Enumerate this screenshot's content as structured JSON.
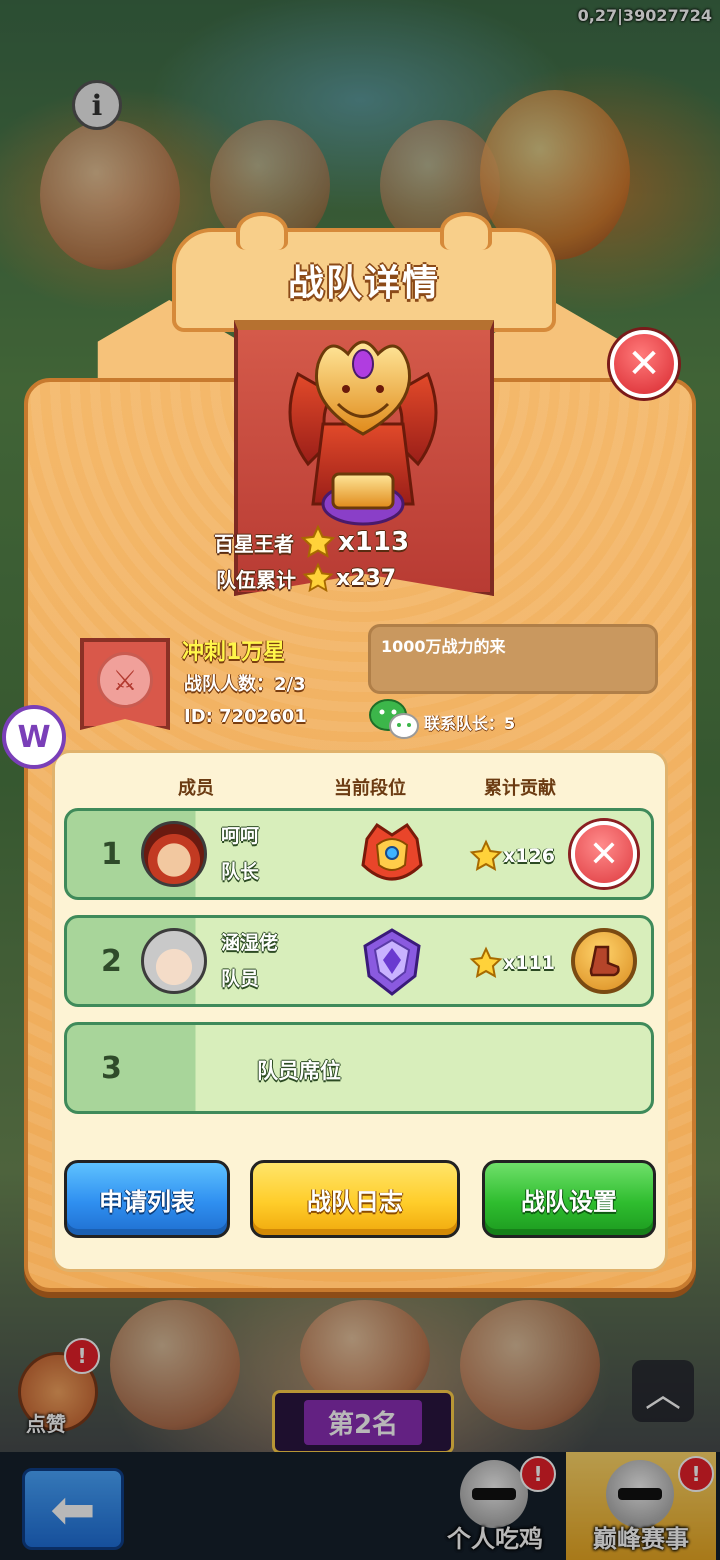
{
  "status": {
    "version_text": "0,27|39027724"
  },
  "background": {
    "like_label": "点赞",
    "rank_badge": "第2名",
    "tabs": [
      {
        "label": "个人吃鸡",
        "badge": "!"
      },
      {
        "label": "巅峰赛事",
        "badge": "!"
      }
    ],
    "like_badge": "!",
    "info_icon": "i",
    "side_icon_letter": "W"
  },
  "dialog": {
    "title": "战队详情",
    "close_glyph": "✕",
    "stats": [
      {
        "label": "百星王者",
        "value": "x113"
      },
      {
        "label": "队伍累计",
        "value": "x237"
      }
    ],
    "team": {
      "name": "冲刺1万星",
      "member_count": "战队人数：2/3",
      "id": "ID: 7202601",
      "motto": "1000万战力的来",
      "contact": "联系队长：5"
    },
    "columns": {
      "member": "成员",
      "rank": "当前段位",
      "contribution": "累计贡献"
    },
    "members": [
      {
        "index": "1",
        "name": "呵呵",
        "role": "队长",
        "contribution": "x126",
        "action": "kick"
      },
      {
        "index": "2",
        "name": "涵湿佬",
        "role": "队员",
        "contribution": "x111",
        "action": "boot"
      }
    ],
    "empty_slot": {
      "index": "3",
      "label": "队员席位"
    },
    "buttons": {
      "apply_list": "申请列表",
      "team_log": "战队日志",
      "team_settings": "战队设置"
    }
  },
  "colors": {
    "panel": "#f4b86a",
    "title_stroke": "#8b4a18",
    "row_border": "#3f8a5a",
    "btn_blue": "#2f8ff0",
    "btn_yellow": "#ffcd2a",
    "btn_green": "#2fbd2f",
    "close_red": "#de3a3f"
  }
}
